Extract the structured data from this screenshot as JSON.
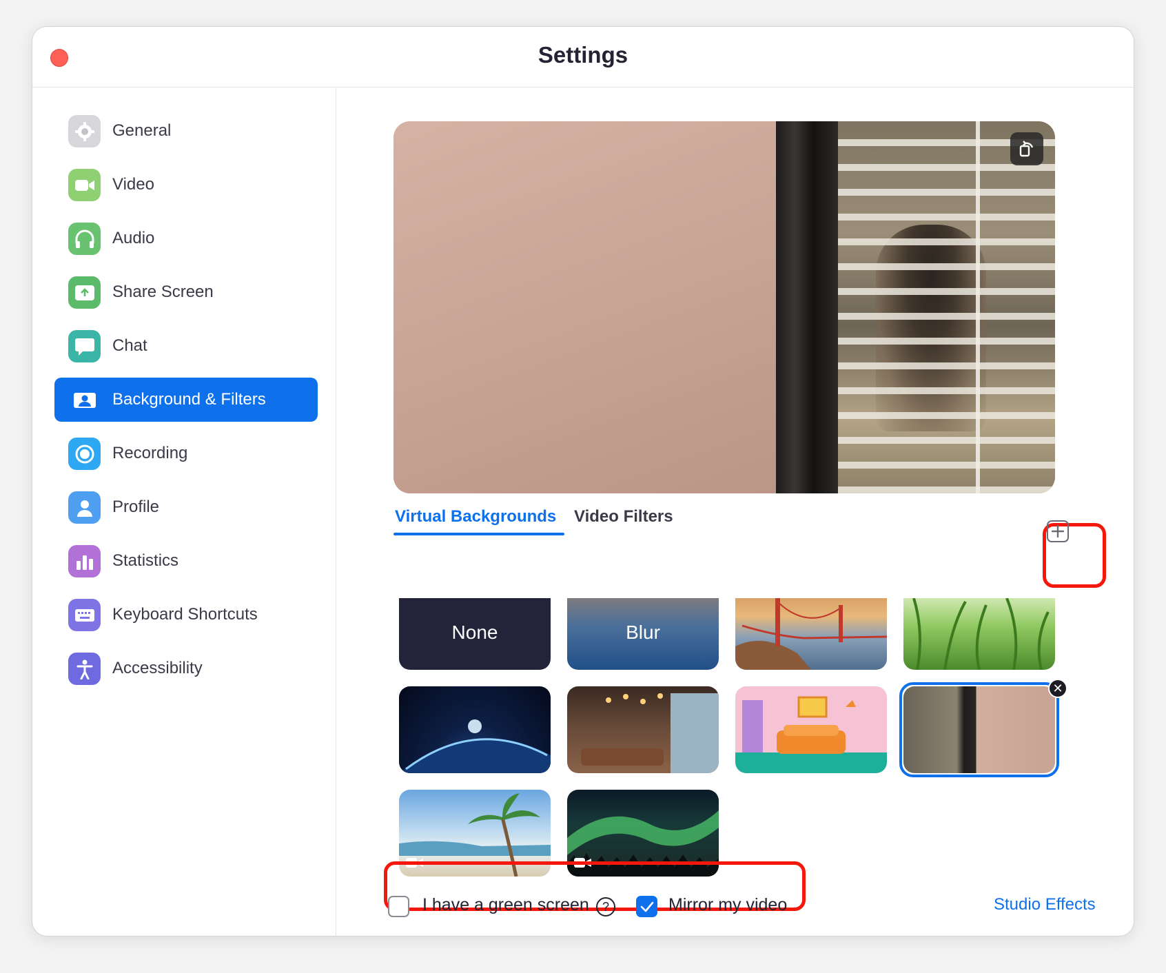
{
  "window": {
    "title": "Settings"
  },
  "sidebar": {
    "items": [
      {
        "label": "General",
        "icon": "gear-icon",
        "color": "#d7d7db",
        "active": false
      },
      {
        "label": "Video",
        "icon": "video-camera-icon",
        "color": "#8fd172",
        "active": false
      },
      {
        "label": "Audio",
        "icon": "headphones-icon",
        "color": "#69c26f",
        "active": false
      },
      {
        "label": "Share Screen",
        "icon": "share-screen-icon",
        "color": "#5cbb6a",
        "active": false
      },
      {
        "label": "Chat",
        "icon": "chat-bubble-icon",
        "color": "#3bb5a7",
        "active": false
      },
      {
        "label": "Background & Filters",
        "icon": "person-card-icon",
        "color": "#0e71eb",
        "active": true
      },
      {
        "label": "Recording",
        "icon": "record-icon",
        "color": "#2ea8f2",
        "active": false
      },
      {
        "label": "Profile",
        "icon": "profile-icon",
        "color": "#4e9ff0",
        "active": false
      },
      {
        "label": "Statistics",
        "icon": "bar-chart-icon",
        "color": "#b271d6",
        "active": false
      },
      {
        "label": "Keyboard Shortcuts",
        "icon": "keyboard-icon",
        "color": "#7e74e6",
        "active": false
      },
      {
        "label": "Accessibility",
        "icon": "accessibility-icon",
        "color": "#6f6ae0",
        "active": false
      }
    ]
  },
  "main": {
    "tabs": [
      {
        "label": "Virtual Backgrounds",
        "active": true
      },
      {
        "label": "Video Filters",
        "active": false
      }
    ],
    "backgrounds": [
      {
        "label": "None",
        "kind": "none"
      },
      {
        "label": "Blur",
        "kind": "blur"
      },
      {
        "kind": "golden-gate"
      },
      {
        "kind": "grass"
      },
      {
        "kind": "earth-from-space"
      },
      {
        "kind": "lounge"
      },
      {
        "kind": "cartoon-living-room"
      },
      {
        "kind": "custom-office",
        "selected": true
      },
      {
        "kind": "beach",
        "video": true
      },
      {
        "kind": "aurora",
        "video": true
      }
    ],
    "green_screen": {
      "label": "I have a green screen",
      "checked": false
    },
    "mirror_video": {
      "label": "Mirror my video",
      "checked": true
    },
    "studio_effects": "Studio Effects",
    "help_glyph": "?",
    "remove_glyph": "✕"
  },
  "colors": {
    "accent": "#0e71eb",
    "highlight": "#f5170c",
    "close": "#fe5f57"
  }
}
